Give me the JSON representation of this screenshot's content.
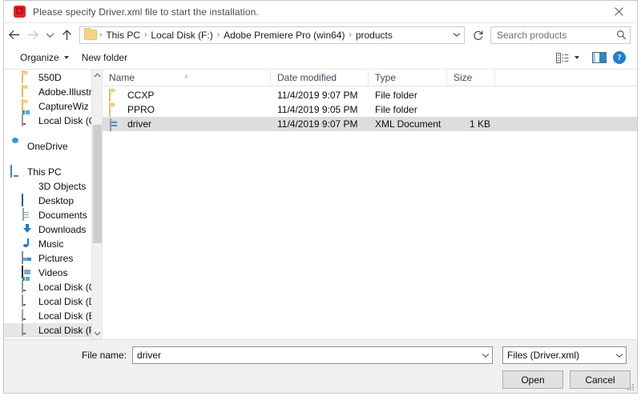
{
  "window": {
    "title": "Please specify Driver.xml file to start the installation.",
    "app_icon": "adobe-red-icon",
    "close_label": "✕"
  },
  "nav": {
    "back": "←",
    "forward": "→",
    "recent": "ˇ",
    "up": "↑",
    "refresh": "↻",
    "dropdown": "ˇ"
  },
  "breadcrumb": {
    "folder_icon": "folder-icon",
    "separator": "›",
    "items": [
      "This PC",
      "Local Disk (F:)",
      "Adobe Premiere Pro (win64)",
      "products"
    ]
  },
  "search": {
    "placeholder": "Search products",
    "icon": "search-icon"
  },
  "toolbar": {
    "organize": "Organize",
    "new_folder": "New folder",
    "view_icon": "list-view-icon",
    "preview_icon": "preview-pane-icon",
    "help_icon": "help-icon",
    "help_glyph": "?"
  },
  "sidebar": {
    "items": [
      {
        "label": "550D",
        "icon": "folder-icon",
        "indent": 1,
        "selected": false
      },
      {
        "label": "Adobe.Illustrator",
        "icon": "folder-icon",
        "indent": 1,
        "selected": false
      },
      {
        "label": "CaptureWiz",
        "icon": "folder-icon",
        "indent": 1,
        "selected": false
      },
      {
        "label": "Local Disk (C:)",
        "icon": "drive-system-icon",
        "indent": 1,
        "selected": false
      },
      {
        "label": "",
        "icon": "spacer",
        "indent": 0,
        "selected": false
      },
      {
        "label": "OneDrive",
        "icon": "onedrive-icon",
        "indent": 0,
        "selected": false
      },
      {
        "label": "",
        "icon": "spacer",
        "indent": 0,
        "selected": false
      },
      {
        "label": "This PC",
        "icon": "this-pc-icon",
        "indent": 0,
        "selected": false
      },
      {
        "label": "3D Objects",
        "icon": "3d-objects-icon",
        "indent": 1,
        "selected": false
      },
      {
        "label": "Desktop",
        "icon": "desktop-icon",
        "indent": 1,
        "selected": false
      },
      {
        "label": "Documents",
        "icon": "documents-icon",
        "indent": 1,
        "selected": false
      },
      {
        "label": "Downloads",
        "icon": "downloads-icon",
        "indent": 1,
        "selected": false
      },
      {
        "label": "Music",
        "icon": "music-icon",
        "indent": 1,
        "selected": false
      },
      {
        "label": "Pictures",
        "icon": "pictures-icon",
        "indent": 1,
        "selected": false
      },
      {
        "label": "Videos",
        "icon": "videos-icon",
        "indent": 1,
        "selected": false
      },
      {
        "label": "Local Disk (C:)",
        "icon": "drive-system-icon",
        "indent": 1,
        "selected": false
      },
      {
        "label": "Local Disk (D:)",
        "icon": "drive-icon",
        "indent": 1,
        "selected": false
      },
      {
        "label": "Local Disk (E:)",
        "icon": "drive-icon",
        "indent": 1,
        "selected": false
      },
      {
        "label": "Local Disk (F:)",
        "icon": "drive-icon",
        "indent": 1,
        "selected": true
      }
    ],
    "scroll_up": "˄",
    "scroll_down": "˅"
  },
  "filelist": {
    "columns": [
      "Name",
      "Date modified",
      "Type",
      "Size"
    ],
    "sort_indicator": "˄",
    "rows": [
      {
        "name": "CCXP",
        "date": "11/4/2019 9:07 PM",
        "type": "File folder",
        "size": "",
        "icon": "folder-icon",
        "selected": false
      },
      {
        "name": "PPRO",
        "date": "11/4/2019 9:05 PM",
        "type": "File folder",
        "size": "",
        "icon": "folder-icon",
        "selected": false
      },
      {
        "name": "driver",
        "date": "11/4/2019 9:07 PM",
        "type": "XML Document",
        "size": "1 KB",
        "icon": "xml-document-icon",
        "selected": true
      }
    ]
  },
  "footer": {
    "file_name_label": "File name:",
    "file_name_value": "driver",
    "file_type_value": "Files (Driver.xml)",
    "open_label": "Open",
    "cancel_label": "Cancel",
    "dropdown_glyph": "˅"
  },
  "colors": {
    "selection": "#dddddd",
    "sidebar_selection": "#e6e6e6",
    "accent_blue": "#1f7fd0",
    "folder_yellow": "#f7d384",
    "footer_bg": "#f0f0f0"
  }
}
